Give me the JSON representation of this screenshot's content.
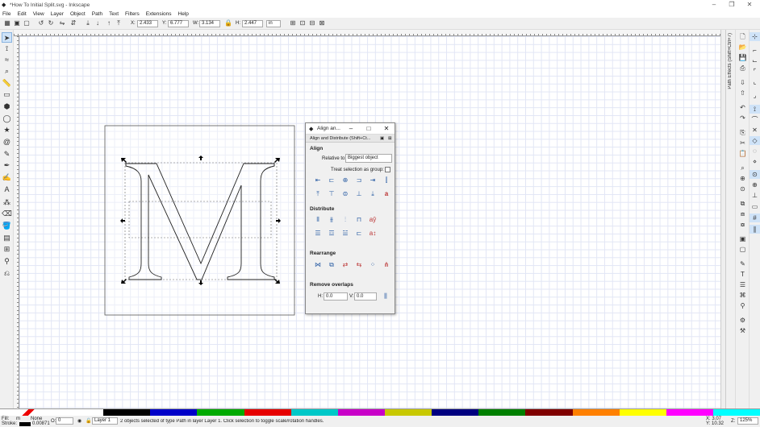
{
  "window": {
    "title": "*How To Initial Split.svg - Inkscape",
    "minimize": "–",
    "maximize": "❐",
    "close": "✕"
  },
  "menu": [
    "File",
    "Edit",
    "View",
    "Layer",
    "Object",
    "Path",
    "Text",
    "Filters",
    "Extensions",
    "Help"
  ],
  "toolbar": {
    "x_label": "X:",
    "x_value": "2.433",
    "y_label": "Y:",
    "y_value": "6.777",
    "w_label": "W:",
    "w_value": "3.134",
    "h_label": "H:",
    "h_value": "2.447",
    "unit": "in"
  },
  "dialog": {
    "title": "Align an...",
    "tab_label": "Align and Distribute (Shift+Ct...",
    "align_heading": "Align",
    "relative_to_label": "Relative to:",
    "relative_to_value": "Biggest object",
    "treat_group_label": "Treat selection as group:",
    "distribute_heading": "Distribute",
    "rearrange_heading": "Rearrange",
    "remove_overlaps_heading": "Remove overlaps",
    "h_label": "H:",
    "h_value": "0.0",
    "v_label": "V:",
    "v_value": "0.0"
  },
  "canvas": {
    "glyph": "M"
  },
  "panel_tab": "Path Effects (Shift+Ctrl+7)",
  "palette_colors": [
    "#ffffff",
    "#000000",
    "#0000c8",
    "#00aa00",
    "#e60000",
    "#00c8c8",
    "#c800c8",
    "#c8c800",
    "#000080",
    "#008000",
    "#800000",
    "#ff8000",
    "#ffff00",
    "#ff00ff",
    "#00ffff"
  ],
  "status": {
    "fill_label": "Fill:",
    "fill_value": "m",
    "stroke_label": "Stroke:",
    "fill_none": "None",
    "stroke_width": "0.00871",
    "opacity_label": "O:",
    "opacity_value": "0",
    "layer": "Layer 1",
    "message": "2 objects selected of type Path in layer Layer 1. Click selection to toggle scale/rotation handles.",
    "x_coord": "X: 3.07",
    "y_coord": "Y: 10.32",
    "zoom_label": "Z:",
    "zoom": "125%"
  }
}
